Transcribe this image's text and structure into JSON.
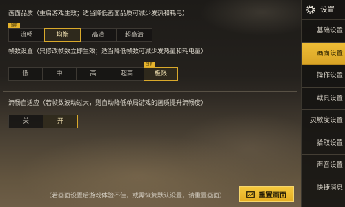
{
  "corner_icon": "square-outline-icon",
  "sections": [
    {
      "title": "画面品质（重启游戏生效；适当降低画面品质可减少发热和耗电）",
      "options": [
        {
          "label": "流畅",
          "tag": "当前"
        },
        {
          "label": "均衡",
          "selected": true
        },
        {
          "label": "高清"
        },
        {
          "label": "超高清"
        }
      ]
    },
    {
      "title": "帧数设置（只修改帧数立即生效；适当降低帧数可减少发热量和耗电量）",
      "options": [
        {
          "label": "低"
        },
        {
          "label": "中"
        },
        {
          "label": "高"
        },
        {
          "label": "超高"
        },
        {
          "label": "极限",
          "tag": "当前",
          "selected": true
        }
      ]
    },
    {
      "title": "流畅自适应（若帧数波动过大，则自动降低单局游戏的画质提升流畅度）",
      "options": [
        {
          "label": "关"
        },
        {
          "label": "开",
          "selected": true
        }
      ]
    }
  ],
  "footer": {
    "hint": "（若画面设置后游戏体验不佳，或需恢复默认设置，请重置画面）",
    "reset_button": {
      "label": "重置画面",
      "icon": "reset-icon"
    }
  },
  "sidebar": {
    "header": {
      "title": "设置",
      "icon": "gear-icon"
    },
    "items": [
      {
        "label": "基础设置"
      },
      {
        "label": "画面设置",
        "active": true
      },
      {
        "label": "操作设置"
      },
      {
        "label": "载具设置"
      },
      {
        "label": "灵敏度设置"
      },
      {
        "label": "拾取设置"
      },
      {
        "label": "声音设置"
      },
      {
        "label": "快捷消息"
      }
    ]
  },
  "colors": {
    "accent": "#e4b22c",
    "text": "#d9d4c9",
    "panel": "#151412",
    "active_text": "#2a2000"
  }
}
